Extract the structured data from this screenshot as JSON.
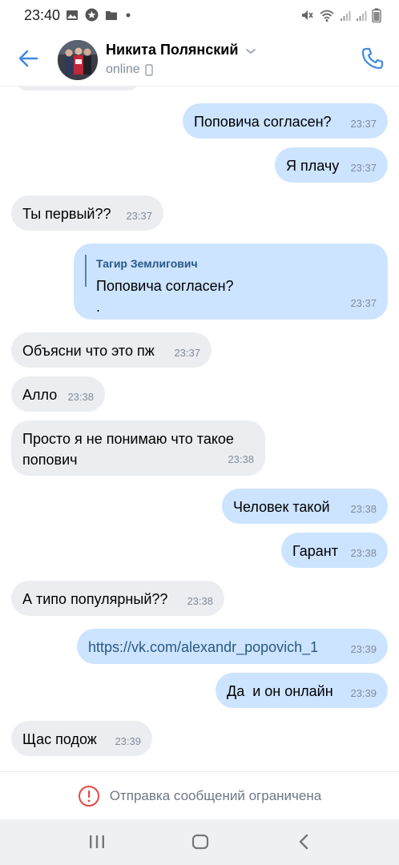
{
  "status_bar": {
    "time": "23:40"
  },
  "header": {
    "name": "Никита Полянский",
    "status": "online"
  },
  "messages": [
    {
      "dir": "out",
      "text": "Поповича согласен?",
      "time": "23:37"
    },
    {
      "dir": "out",
      "text": "Я плачу",
      "time": "23:37"
    },
    {
      "dir": "in",
      "text": "Ты первый??",
      "time": "23:37"
    },
    {
      "dir": "out",
      "reply_author": "Тагир Землигович",
      "reply_text": "Поповича согласен?",
      "text": ".",
      "time": "23:37"
    },
    {
      "dir": "in",
      "text": "Объясни что это пж",
      "time": "23:37"
    },
    {
      "dir": "in",
      "text": "Алло",
      "time": "23:38"
    },
    {
      "dir": "in",
      "text_line1": "Просто я не понимаю что такое",
      "text_line2": "попович",
      "time": "23:38"
    },
    {
      "dir": "out",
      "text": "Человек такой",
      "time": "23:38"
    },
    {
      "dir": "out",
      "text": "Гарант",
      "time": "23:38"
    },
    {
      "dir": "in",
      "text": "А типо популярный??",
      "time": "23:38"
    },
    {
      "dir": "out",
      "text": "https://vk.com/alexandr_popovich_1",
      "time": "23:39"
    },
    {
      "dir": "out",
      "text": "Да  и он онлайн",
      "time": "23:39"
    },
    {
      "dir": "in",
      "text": "Щас подож",
      "time": "23:39"
    }
  ],
  "footer": {
    "restricted_text": "Отправка сообщений ограничена"
  },
  "colors": {
    "accent": "#3f8ae0",
    "incoming_bubble": "#ebedf0",
    "outgoing_bubble": "#cce4ff",
    "warning": "#e64646"
  }
}
